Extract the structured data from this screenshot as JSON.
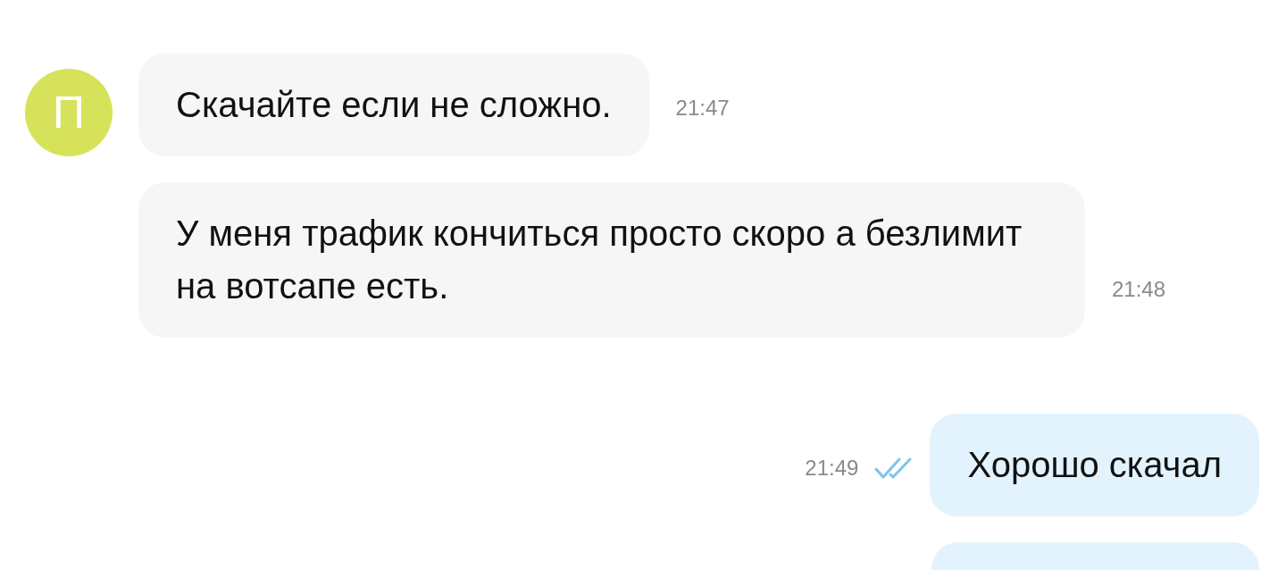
{
  "messages": [
    {
      "kind": "incoming",
      "avatar": {
        "letter": "П"
      },
      "text": "Скачайте если не сложно.",
      "time": "21:47"
    },
    {
      "kind": "incoming",
      "text": "У меня трафик кончиться просто скоро а безлимит на вотсапе есть.",
      "time": "21:48"
    },
    {
      "kind": "outgoing",
      "text": "Хорошо скачал",
      "time": "21:49",
      "read": true
    },
    {
      "kind": "outgoing"
    }
  ]
}
